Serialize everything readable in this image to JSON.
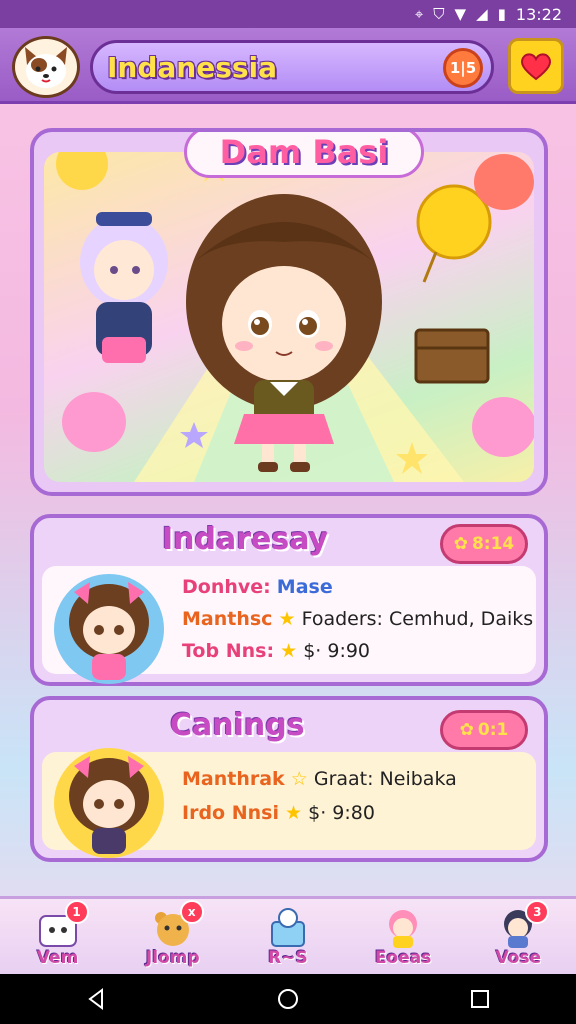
{
  "status_bar": {
    "time": "13:22"
  },
  "header": {
    "title": "Indanessia",
    "badge": "1|5"
  },
  "hero": {
    "title": "Dam Basi"
  },
  "cards": [
    {
      "title": "Indaresay",
      "badge": "8:14",
      "rows": [
        {
          "label": "Donhve:",
          "value": "Mase"
        },
        {
          "label": "Manthsc",
          "value": "Foaders: Cemhud, Daiks"
        },
        {
          "label": "Tob Nns:",
          "value": "$· 9:90"
        }
      ]
    },
    {
      "title": "Canings",
      "badge": "0:1",
      "rows": [
        {
          "label": "Manthrak",
          "value": "Graat: Neibaka"
        },
        {
          "label": "Irdo Nnsi",
          "value": "$· 9:80"
        }
      ]
    }
  ],
  "nav": [
    {
      "label": "Vem",
      "badge": "1"
    },
    {
      "label": "Jlomp",
      "badge": "x"
    },
    {
      "label": "R~S",
      "badge": ""
    },
    {
      "label": "Eoeas",
      "badge": ""
    },
    {
      "label": "Vose",
      "badge": "3"
    }
  ],
  "colors": {
    "accent": "#a769d3",
    "header": "#9a5cc6",
    "title": "#ffe14a",
    "badge": "#ff7aa8"
  }
}
